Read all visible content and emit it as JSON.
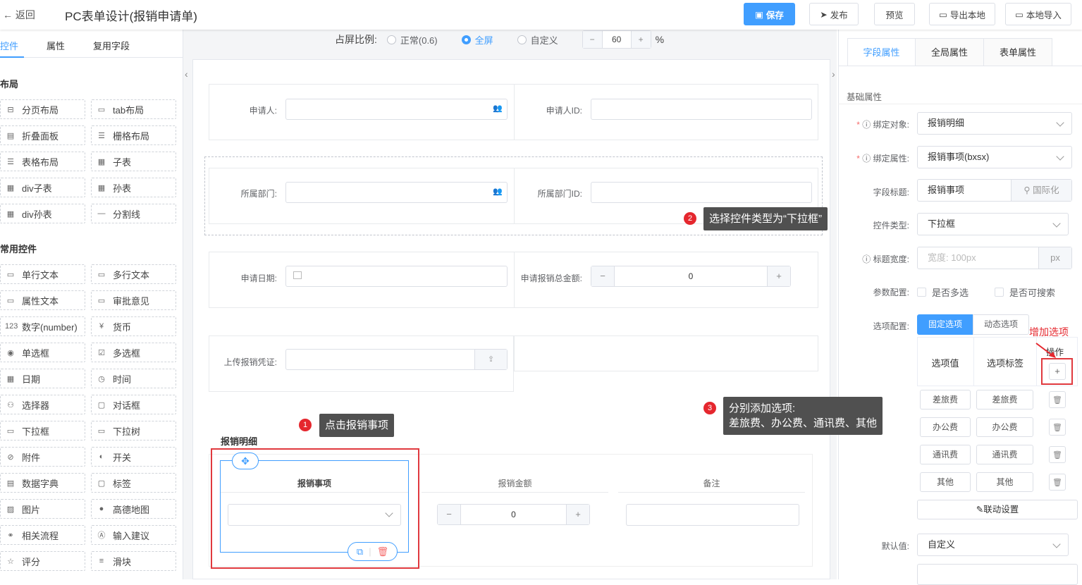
{
  "header": {
    "back": "返回",
    "title": "PC表单设计(报销申请单)",
    "save": "保存",
    "publish": "发布",
    "preview": "预览",
    "export": "导出本地",
    "import": "本地导入"
  },
  "left": {
    "tabs": [
      "控件",
      "属性",
      "复用字段"
    ],
    "layout_title": "布局",
    "layout_items": [
      "分页布局",
      "tab布局",
      "折叠面板",
      "栅格布局",
      "表格布局",
      "子表",
      "div子表",
      "孙表",
      "div孙表",
      "分割线"
    ],
    "common_title": "常用控件",
    "common_items": [
      "单行文本",
      "多行文本",
      "属性文本",
      "审批意见",
      "数字(number)",
      "货币",
      "单选框",
      "多选框",
      "日期",
      "时间",
      "选择器",
      "对话框",
      "下拉框",
      "下拉树",
      "附件",
      "开关",
      "数据字典",
      "标签",
      "图片",
      "高德地图",
      "相关流程",
      "输入建议",
      "评分",
      "滑块"
    ],
    "icons": [
      "split-icon",
      "tab-icon",
      "collapse-icon",
      "grid-icon",
      "table-layout-icon",
      "subtable-icon",
      "div-subtable-icon",
      "grandtable-icon",
      "div-grandtable-icon",
      "divider-icon",
      "input-icon",
      "textarea-icon",
      "attr-text-icon",
      "approval-icon",
      "number-icon",
      "currency-icon",
      "radio-icon",
      "checkbox-icon",
      "date-icon",
      "time-icon",
      "selector-icon",
      "dialog-icon",
      "select-icon",
      "tree-select-icon",
      "attachment-icon",
      "switch-icon",
      "dictionary-icon",
      "tag-icon",
      "image-icon",
      "map-icon",
      "flow-icon",
      "suggest-icon",
      "star-icon",
      "slider-icon"
    ]
  },
  "ratio": {
    "label": "占屏比例:",
    "normal": "正常(0.6)",
    "full": "全屏",
    "custom": "自定义",
    "value": "60",
    "unit": "%"
  },
  "form": {
    "applicant": "申请人:",
    "applicant_id": "申请人ID:",
    "dept": "所属部门:",
    "dept_id": "所属部门ID:",
    "date": "申请日期:",
    "total": "申请报销总金额:",
    "total_value": "0",
    "upload": "上传报销凭证:",
    "detail_title": "报销明细",
    "col1": "报销事项",
    "col2": "报销金额",
    "col3": "备注",
    "amount_value": "0"
  },
  "tips": {
    "t1": "点击报销事项",
    "n1": "1",
    "t2": "选择控件类型为“下拉框”",
    "n2": "2",
    "t3a": "分别添加选项:",
    "t3b": "差旅费、办公费、通讯费、其他",
    "n3": "3",
    "add_option": "增加选项"
  },
  "right": {
    "tabs": [
      "字段属性",
      "全局属性",
      "表单属性"
    ],
    "basic": "基础属性",
    "bind_obj_label": "绑定对象:",
    "bind_obj": "报销明细",
    "bind_attr_label": "绑定属性:",
    "bind_attr": "报销事项(bxsx)",
    "field_title_label": "字段标题:",
    "field_title": "报销事项",
    "intl": "国际化",
    "ctrl_type_label": "控件类型:",
    "ctrl_type": "下拉框",
    "title_width_label": "标题宽度:",
    "title_width_ph": "宽度: 100px",
    "px": "px",
    "param_label": "参数配置:",
    "multi": "是否多选",
    "searchable": "是否可搜索",
    "opt_label": "选项配置:",
    "fixed": "固定选项",
    "dynamic": "动态选项",
    "op_col": "操作",
    "val_col": "选项值",
    "lbl_col": "选项标签",
    "options": [
      {
        "v": "差旅费",
        "l": "差旅费"
      },
      {
        "v": "办公费",
        "l": "办公费"
      },
      {
        "v": "通讯费",
        "l": "通讯费"
      },
      {
        "v": "其他",
        "l": "其他"
      }
    ],
    "link": "联动设置",
    "default_label": "默认值:",
    "default": "自定义"
  },
  "colors": {
    "accent": "#409eff",
    "annotation": "#e5272e"
  }
}
